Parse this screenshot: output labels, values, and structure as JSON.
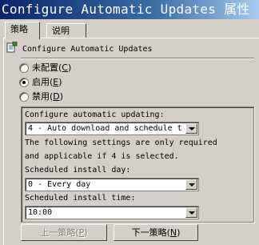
{
  "window": {
    "title": "Configure Automatic Updates 属性"
  },
  "tabs": [
    {
      "label": "策略"
    },
    {
      "label": "说明"
    }
  ],
  "policy": {
    "name": "Configure Automatic Updates",
    "icon": "policy-icon"
  },
  "radios": [
    {
      "label": "未配置",
      "key": "C",
      "selected": false
    },
    {
      "label": "启用",
      "key": "E",
      "selected": true
    },
    {
      "label": "禁用",
      "key": "D",
      "selected": false
    }
  ],
  "options": {
    "configure_label": "Configure automatic updating:",
    "configure_value": "4 - Auto download and schedule t",
    "note_line1": "The following settings are only required",
    "note_line2": "and applicable if 4 is selected.",
    "day_label": "Scheduled install day:",
    "day_value": "0 - Every day",
    "time_label": "Scheduled install time:",
    "time_value": "10:00"
  },
  "buttons": {
    "prev": {
      "label": "上一策略",
      "key": "P",
      "enabled": false
    },
    "next": {
      "label": "下一策略",
      "key": "N",
      "enabled": true
    }
  },
  "colors": {
    "titlebar_start": "#0a246a",
    "titlebar_end": "#a6caf0",
    "face": "#d4d0c8"
  }
}
